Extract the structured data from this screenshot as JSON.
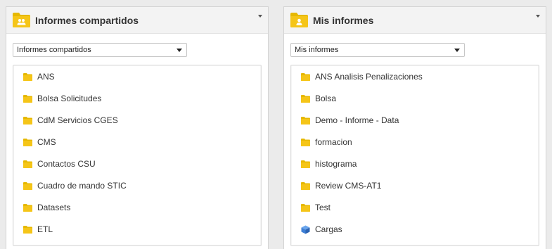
{
  "colors": {
    "folder": "#f5c518",
    "folder_header": "#e6b800",
    "cube": "#3d7fd6"
  },
  "shared": {
    "title": "Informes compartidos",
    "icon": "folder-users-icon",
    "select_value": "Informes compartidos",
    "items": [
      {
        "label": "ANS",
        "icon": "folder-icon"
      },
      {
        "label": "Bolsa Solicitudes",
        "icon": "folder-icon"
      },
      {
        "label": "CdM Servicios CGES",
        "icon": "folder-icon"
      },
      {
        "label": "CMS",
        "icon": "folder-icon"
      },
      {
        "label": "Contactos CSU",
        "icon": "folder-icon"
      },
      {
        "label": "Cuadro de mando STIC",
        "icon": "folder-icon"
      },
      {
        "label": "Datasets",
        "icon": "folder-icon"
      },
      {
        "label": "ETL",
        "icon": "folder-icon"
      }
    ]
  },
  "mine": {
    "title": "Mis informes",
    "icon": "folder-user-icon",
    "select_value": "Mis informes",
    "items": [
      {
        "label": "ANS Analisis Penalizaciones",
        "icon": "folder-icon"
      },
      {
        "label": "Bolsa",
        "icon": "folder-icon"
      },
      {
        "label": "Demo - Informe - Data",
        "icon": "folder-icon"
      },
      {
        "label": "formacion",
        "icon": "folder-icon"
      },
      {
        "label": "histograma",
        "icon": "folder-icon"
      },
      {
        "label": "Review CMS-AT1",
        "icon": "folder-icon"
      },
      {
        "label": "Test",
        "icon": "folder-icon"
      },
      {
        "label": "Cargas",
        "icon": "cube-icon"
      }
    ]
  }
}
